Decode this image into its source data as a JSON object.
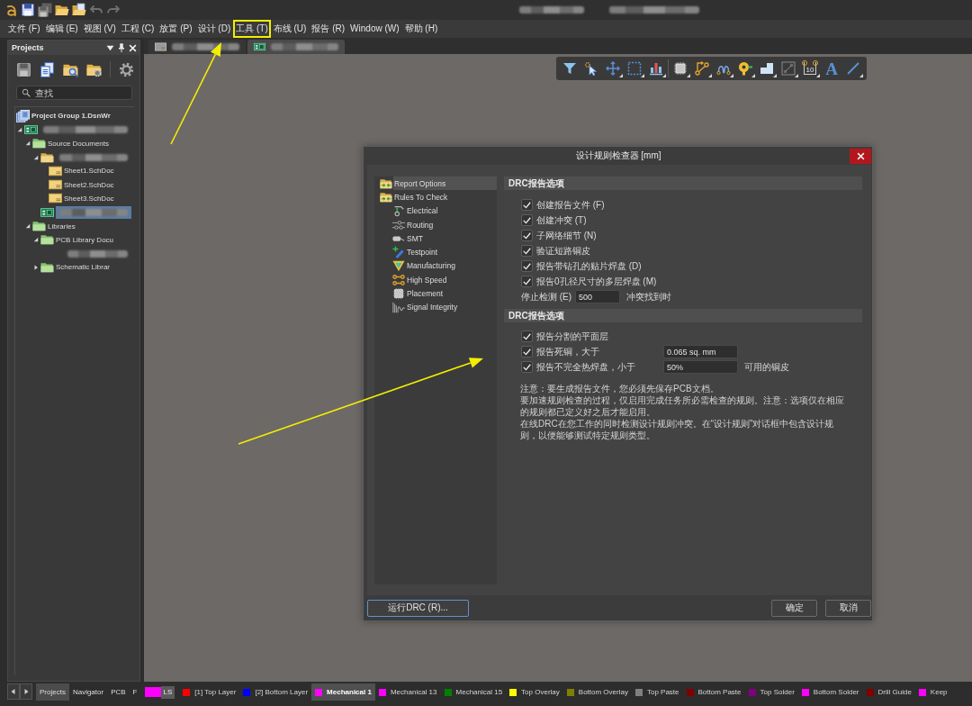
{
  "window": {
    "title_redacted": true
  },
  "quick_access": [
    {
      "kind": "save",
      "disabled": false
    },
    {
      "kind": "save_all",
      "disabled": true
    },
    {
      "kind": "open",
      "disabled": false
    },
    {
      "kind": "open_project",
      "disabled": false
    },
    {
      "kind": "undo",
      "disabled": true
    },
    {
      "kind": "redo",
      "disabled": true
    }
  ],
  "menu": [
    {
      "label": "文件 (F)",
      "highlighted": false
    },
    {
      "label": "编辑 (E)",
      "highlighted": false
    },
    {
      "label": "视图 (V)",
      "highlighted": false
    },
    {
      "label": "工程 (C)",
      "highlighted": false
    },
    {
      "label": "放置 (P)",
      "highlighted": false
    },
    {
      "label": "设计 (D)",
      "highlighted": false
    },
    {
      "label": "工具 (T)",
      "highlighted": true
    },
    {
      "label": "布线 (U)",
      "highlighted": false
    },
    {
      "label": "报告 (R)",
      "highlighted": false
    },
    {
      "label": "Window (W)",
      "highlighted": false
    },
    {
      "label": "帮助 (H)",
      "highlighted": false
    }
  ],
  "projects_panel": {
    "title": "Projects",
    "toolbar": [
      {
        "kind": "save",
        "disabled": true
      },
      {
        "kind": "documents",
        "disabled": false
      },
      {
        "kind": "folder_search",
        "disabled": false
      },
      {
        "kind": "folder_settings",
        "disabled": false
      },
      {
        "kind": "settings",
        "disabled": false
      }
    ],
    "search": {
      "placeholder": "查找"
    },
    "tree": [
      {
        "label": "Project Group 1.DsnWr",
        "kind": "project_group",
        "selected": false,
        "children": [
          {
            "redacted": true,
            "kind": "pcb_project",
            "expanded": true,
            "selected": false,
            "children": [
              {
                "label": "Source Documents",
                "kind": "folder",
                "expanded": true,
                "selected": false,
                "children": [
                  {
                    "redacted": true,
                    "kind": "schematic_folder",
                    "expanded": true,
                    "selected": false,
                    "children": [
                      {
                        "label": "Sheet1.SchDoc",
                        "kind": "schematic",
                        "selected": false
                      },
                      {
                        "label": "Sheet2.SchDoc",
                        "kind": "schematic",
                        "selected": false
                      },
                      {
                        "label": "Sheet3.SchDoc",
                        "kind": "schematic",
                        "selected": false
                      }
                    ]
                  },
                  {
                    "redacted": true,
                    "kind": "pcb",
                    "selected": true
                  }
                ]
              },
              {
                "label": "Libraries",
                "kind": "folder",
                "expanded": true,
                "selected": false,
                "children": [
                  {
                    "label": "PCB Library Docu",
                    "kind": "folder",
                    "expanded": true,
                    "selected": false,
                    "children": [
                      {
                        "redacted": true,
                        "selected": false
                      }
                    ]
                  },
                  {
                    "label": "Schematic Librar",
                    "kind": "folder",
                    "expanded": false,
                    "selected": false
                  }
                ]
              }
            ]
          }
        ]
      }
    ]
  },
  "document_tabs": [
    {
      "kind": "document",
      "selected": false
    },
    {
      "kind": "pcb",
      "selected": true
    }
  ],
  "pcb_toolbar": [
    {
      "kind": "filter",
      "dropdown": false
    },
    {
      "kind": "select",
      "dropdown": false
    },
    {
      "kind": "move",
      "dropdown": true
    },
    {
      "kind": "rect_select",
      "dropdown": true
    },
    {
      "kind": "align",
      "dropdown": true
    },
    {
      "kind": "component",
      "dropdown": true
    },
    {
      "kind": "route",
      "dropdown": true
    },
    {
      "kind": "diff_pair",
      "dropdown": true
    },
    {
      "kind": "pad",
      "dropdown": true
    },
    {
      "kind": "region",
      "dropdown": true
    },
    {
      "kind": "line_box",
      "dropdown": true
    },
    {
      "kind": "dimension",
      "glyph": "10",
      "dropdown": true
    },
    {
      "kind": "text",
      "glyph": "A",
      "dropdown": false
    },
    {
      "kind": "line",
      "dropdown": true
    }
  ],
  "drc_dialog": {
    "title": "设计规则检查器 [mm]",
    "tree": [
      {
        "label": "Report Options",
        "kind": "folder_rules",
        "selected": true
      },
      {
        "label": "Rules To Check",
        "kind": "folder_rules",
        "selected": false,
        "children": [
          {
            "label": "Electrical",
            "kind": "electrical",
            "selected": false
          },
          {
            "label": "Routing",
            "kind": "routing",
            "selected": false
          },
          {
            "label": "SMT",
            "kind": "smt",
            "selected": false
          },
          {
            "label": "Testpoint",
            "kind": "testpoint",
            "selected": false
          },
          {
            "label": "Manufacturing",
            "kind": "manufacturing",
            "selected": false
          },
          {
            "label": "High Speed",
            "kind": "high_speed",
            "selected": false
          },
          {
            "label": "Placement",
            "kind": "placement",
            "selected": false
          },
          {
            "label": "Signal Integrity",
            "kind": "signal_integrity",
            "selected": false
          }
        ]
      }
    ],
    "sections": [
      {
        "title": "DRC报告选项",
        "rows": [
          {
            "kind": "check",
            "label": "创建报告文件 (F)",
            "checked": true
          },
          {
            "kind": "check",
            "label": "创建冲突 (T)",
            "checked": true
          },
          {
            "kind": "check",
            "label": "子网络细节 (N)",
            "checked": true
          },
          {
            "kind": "check",
            "label": "验证短路铜皮",
            "checked": true
          },
          {
            "kind": "check",
            "label": "报告带钻孔的贴片焊盘 (D)",
            "checked": true
          },
          {
            "kind": "check",
            "label": "报告0孔径尺寸的多层焊盘 (M)",
            "checked": true
          },
          {
            "kind": "value",
            "label": "停止检测 (E)",
            "value": "500",
            "suffix": "冲突找到时"
          }
        ]
      },
      {
        "title": "DRC报告选项",
        "rows": [
          {
            "kind": "check",
            "label": "报告分割的平面层",
            "checked": true
          },
          {
            "kind": "check_value",
            "label": "报告死铜，大于",
            "checked": true,
            "value": "0.065 sq. mm"
          },
          {
            "kind": "check_value",
            "label": "报告不完全热焊盘，小于",
            "checked": true,
            "value": "50%",
            "suffix": "可用的铜皮"
          }
        ]
      }
    ],
    "notes": [
      "注意：要生成报告文件，您必须先保存PCB文档。",
      "要加速规则检查的过程，仅启用完成任务所必需检查的规则。注意：选项仅在相应的规则都已定义好之后才能启用。",
      "在线DRC在您工作的同时检测设计规则冲突。在“设计规则”对话框中包含设计规则，以便能够测试特定规则类型。"
    ],
    "buttons": [
      {
        "kind": "run",
        "label": "运行DRC (R)...",
        "focused": true
      },
      {
        "kind": "ok",
        "label": "确定",
        "focused": false
      },
      {
        "kind": "cancel",
        "label": "取消",
        "focused": false
      }
    ]
  },
  "panel_tabs": [
    {
      "label": "Projects",
      "selected": true
    },
    {
      "label": "Navigator",
      "selected": false
    },
    {
      "label": "PCB",
      "selected": false
    },
    {
      "label": "F",
      "selected": false
    }
  ],
  "layer_bar": {
    "current_layer": {
      "color": "#ff00ff"
    },
    "ls_button": "LS",
    "layers": [
      {
        "label": "[1] Top Layer",
        "color": "#ff0000",
        "selected": false
      },
      {
        "label": "[2] Bottom Layer",
        "color": "#0000ff",
        "selected": false
      },
      {
        "label": "Mechanical 1",
        "color": "#ff00ff",
        "selected": true
      },
      {
        "label": "Mechanical 13",
        "color": "#ff00ff",
        "selected": false
      },
      {
        "label": "Mechanical 15",
        "color": "#008000",
        "selected": false
      },
      {
        "label": "Top Overlay",
        "color": "#ffff00",
        "selected": false
      },
      {
        "label": "Bottom Overlay",
        "color": "#808000",
        "selected": false
      },
      {
        "label": "Top Paste",
        "color": "#808080",
        "selected": false
      },
      {
        "label": "Bottom Paste",
        "color": "#800000",
        "selected": false
      },
      {
        "label": "Top Solder",
        "color": "#800080",
        "selected": false
      },
      {
        "label": "Bottom Solder",
        "color": "#ff00ff",
        "selected": false
      },
      {
        "label": "Drill Guide",
        "color": "#800000",
        "selected": false
      },
      {
        "label": "Keep",
        "color": "#ff00ff",
        "selected": false
      }
    ]
  },
  "annotations": [
    {
      "kind": "arrow"
    },
    {
      "kind": "arrow"
    }
  ]
}
